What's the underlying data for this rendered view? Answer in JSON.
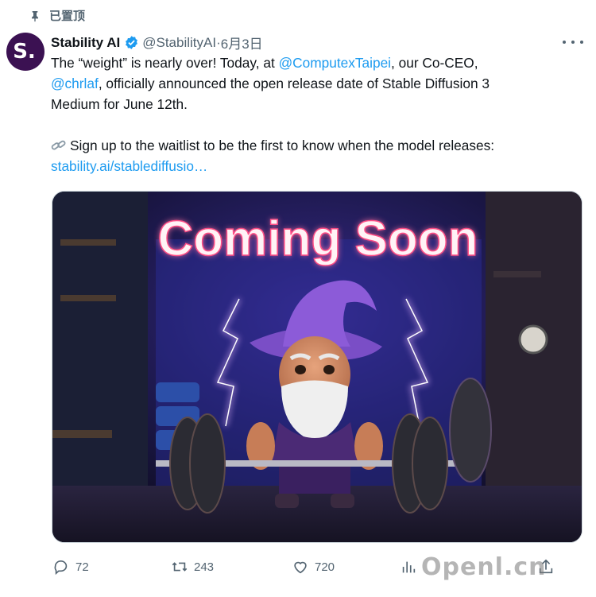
{
  "pinned": {
    "label": "已置顶"
  },
  "author": {
    "avatar_letter": "S.",
    "name": "Stability AI",
    "handle": "@StabilityAI",
    "separator": "·",
    "date": "6月3日"
  },
  "tweet": {
    "line1_a": "The “weight” is nearly over! Today, at ",
    "line1_link": "@ComputexTaipei",
    "line1_b": ", our Co-CEO,",
    "line2_link": "@chrlaf",
    "line2_b": ", officially announced the open release date of Stable Diffusion 3",
    "line3": "Medium for June 12th.",
    "line4": "Sign up to the waitlist to be the first to know when the model releases:",
    "line5_link": "stability.ai/stablediffusio…"
  },
  "media": {
    "headline": "Coming Soon"
  },
  "actions": {
    "replies": "72",
    "retweets": "243",
    "likes": "720"
  },
  "watermark": {
    "text": "Openl.cn"
  },
  "colors": {
    "link": "#1d9bf0",
    "verified": "#1d9bf0",
    "avatar_bg": "#3b1152",
    "muted": "#536471"
  }
}
